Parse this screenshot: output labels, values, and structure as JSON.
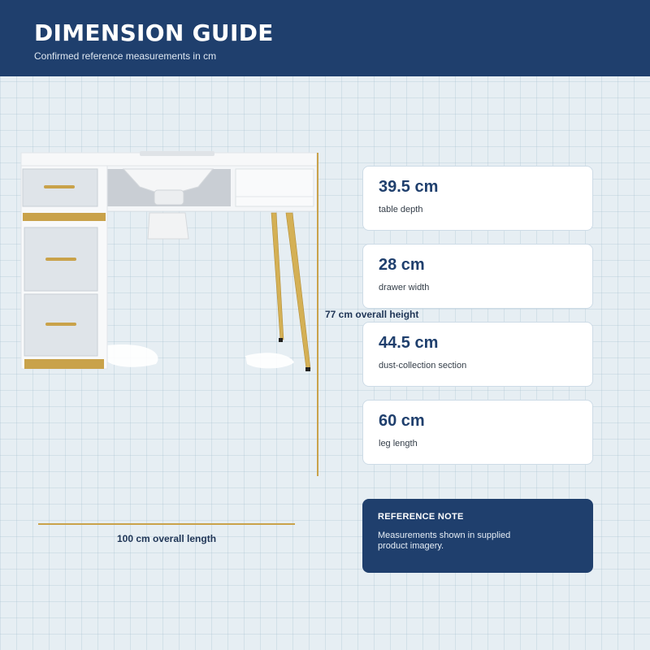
{
  "header": {
    "title": "DIMENSION GUIDE",
    "subtitle": "Confirmed reference measurements in cm"
  },
  "dimensions": {
    "length_label": "100 cm overall length",
    "height_label": "77 cm overall height"
  },
  "cards": [
    {
      "value": "39.5 cm",
      "label": "table depth"
    },
    {
      "value": "28 cm",
      "label": "drawer width"
    },
    {
      "value": "44.5 cm",
      "label": "dust-collection section"
    },
    {
      "value": "60 cm",
      "label": "leg length"
    }
  ],
  "note": {
    "title": "REFERENCE NOTE",
    "body": "Measurements shown in supplied product imagery."
  },
  "colors": {
    "navy": "#1f3f6d",
    "gold": "#c9a24a",
    "background": "#e6eef3",
    "card_text": "#1f3f6d"
  }
}
